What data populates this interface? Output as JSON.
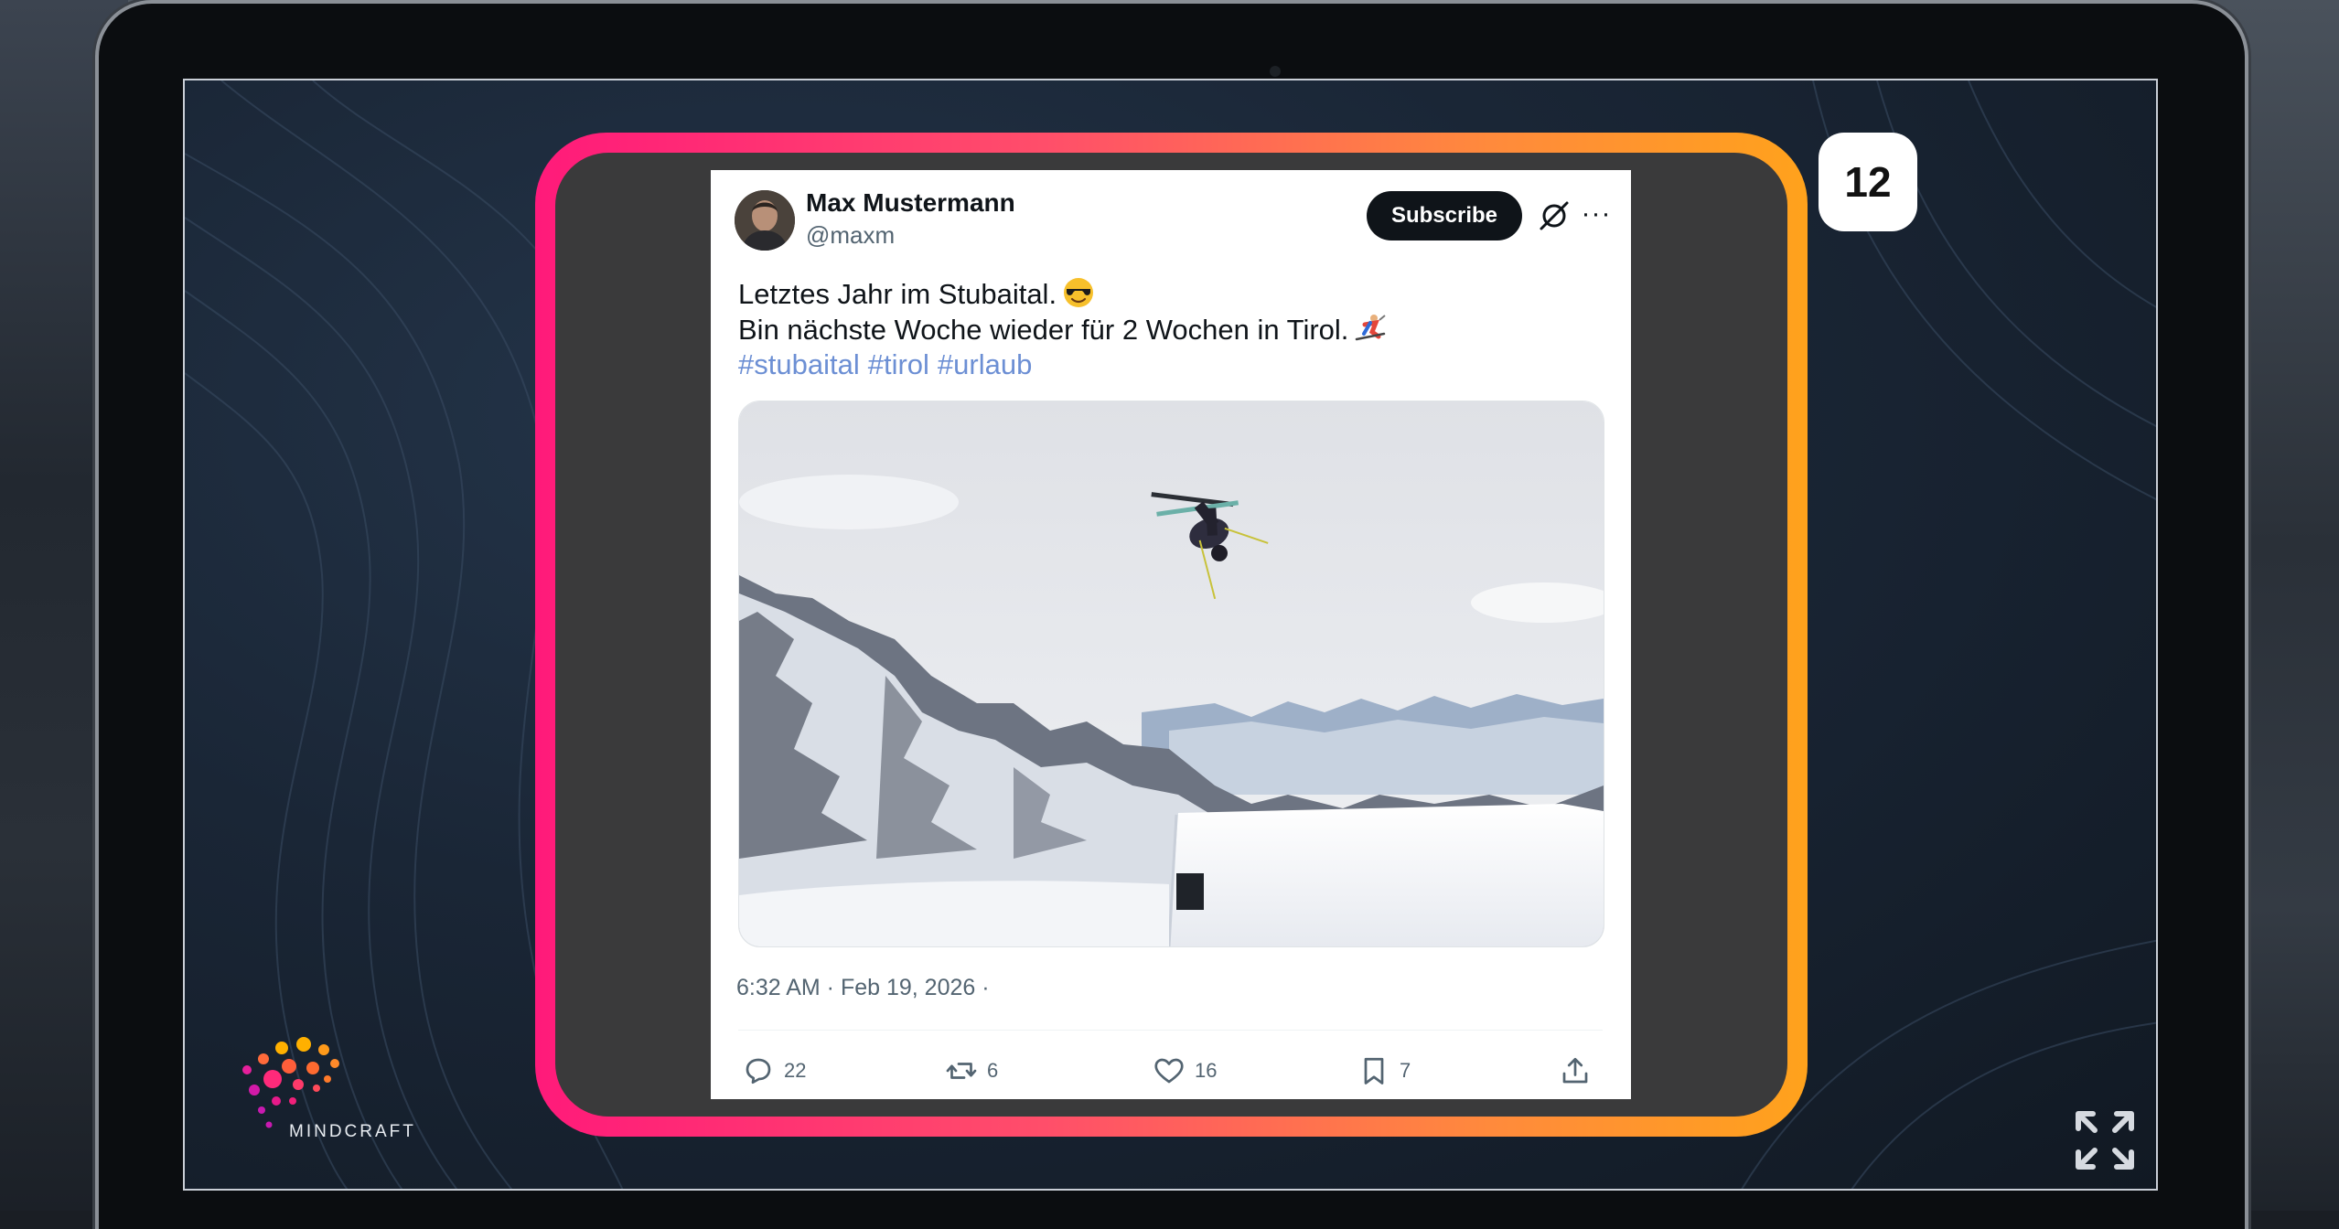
{
  "slide": {
    "number": "12"
  },
  "tweet": {
    "author_name": "Max Mustermann",
    "handle": "@maxm",
    "subscribe_label": "Subscribe",
    "more_label": "···",
    "text_line1": "Letztes Jahr im Stubaital.",
    "text_line2": "Bin nächste Woche wieder für 2 Wochen in Tirol.",
    "emoji1": "sunglasses-emoji",
    "emoji2": "skier-emoji",
    "hashtags": [
      "#stubaital",
      "#tirol",
      "#urlaub"
    ],
    "image": "skier jumping above snowy mountains",
    "timestamp": "6:32 AM · Feb 19, 2026 ·",
    "replies": "22",
    "retweets": "6",
    "likes": "16",
    "bookmarks": "7"
  },
  "branding": {
    "logo_text": "MINDCRAFT"
  },
  "colors": {
    "frame_start": "#ff1a7a",
    "frame_end": "#ffa21c",
    "hashtag": "#6c8fd4",
    "subscribe_bg": "#0f1419"
  },
  "icons": [
    "reply-icon",
    "retweet-icon",
    "like-icon",
    "bookmark-icon",
    "share-icon",
    "grok-icon",
    "fullscreen-icon"
  ]
}
